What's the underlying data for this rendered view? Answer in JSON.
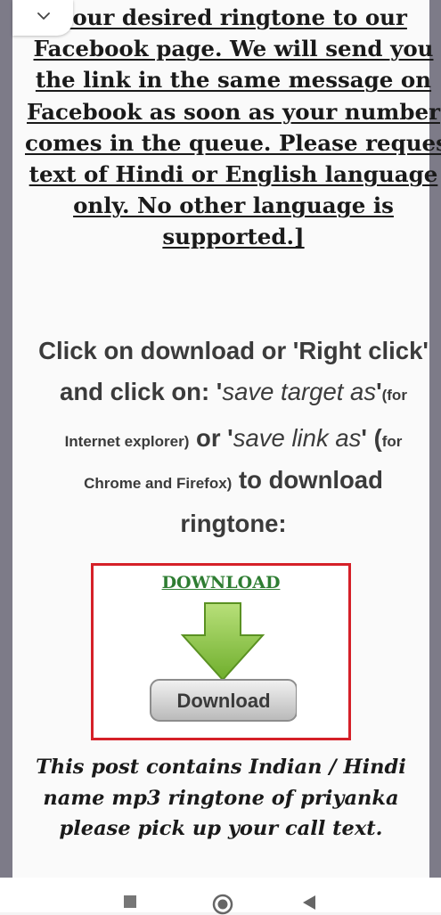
{
  "intro_lines": [
    "your desired ringtone to our",
    "Facebook page. We will send you",
    "the link in the same message on",
    "Facebook as soon as your number",
    "comes in the queue. Please request",
    "text of Hindi or English language",
    "only. No other language is",
    "supported.]"
  ],
  "instructions": {
    "l1": "Click on download or 'Right click'",
    "l2_a": "and click on: '",
    "l2_b": "save target as",
    "l2_c": "'",
    "l2_d": "(for",
    "l3_a": "Internet explorer)",
    "l3_b": " or '",
    "l3_c": "save link as",
    "l3_d": "' (",
    "l3_e": "for",
    "l4_a": "Chrome and Firefox)",
    "l4_b": " to download",
    "l5": "ringtone:"
  },
  "download": {
    "link_text": "DOWNLOAD",
    "button_text": "Download"
  },
  "caption_lines": [
    "This post contains Indian / Hindi",
    "name mp3 ringtone of priyanka",
    "please pick up your call text."
  ],
  "colors": {
    "link_green": "#2e7d32",
    "box_border": "#d52028",
    "side_bar": "#7d7b88"
  },
  "icons": {
    "collapse": "chevron-down-icon",
    "recents": "square-icon",
    "home": "circle-icon",
    "back": "triangle-back-icon"
  }
}
